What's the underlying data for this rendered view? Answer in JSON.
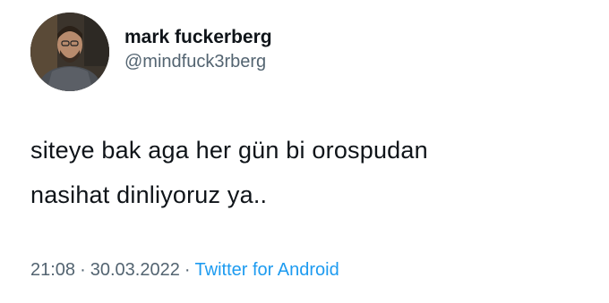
{
  "author": {
    "display_name": "mark fuckerberg",
    "handle": "@mindfuck3rberg"
  },
  "tweet": {
    "text_lines": [
      "siteye bak aga her gün bi orospudan",
      "nasihat dinliyoruz ya.."
    ]
  },
  "meta": {
    "time": "21:08",
    "separator": "·",
    "date": "30.03.2022",
    "source": "Twitter for Android"
  },
  "colors": {
    "text": "#0f1419",
    "secondary": "#536471",
    "link": "#1d9bf0"
  }
}
